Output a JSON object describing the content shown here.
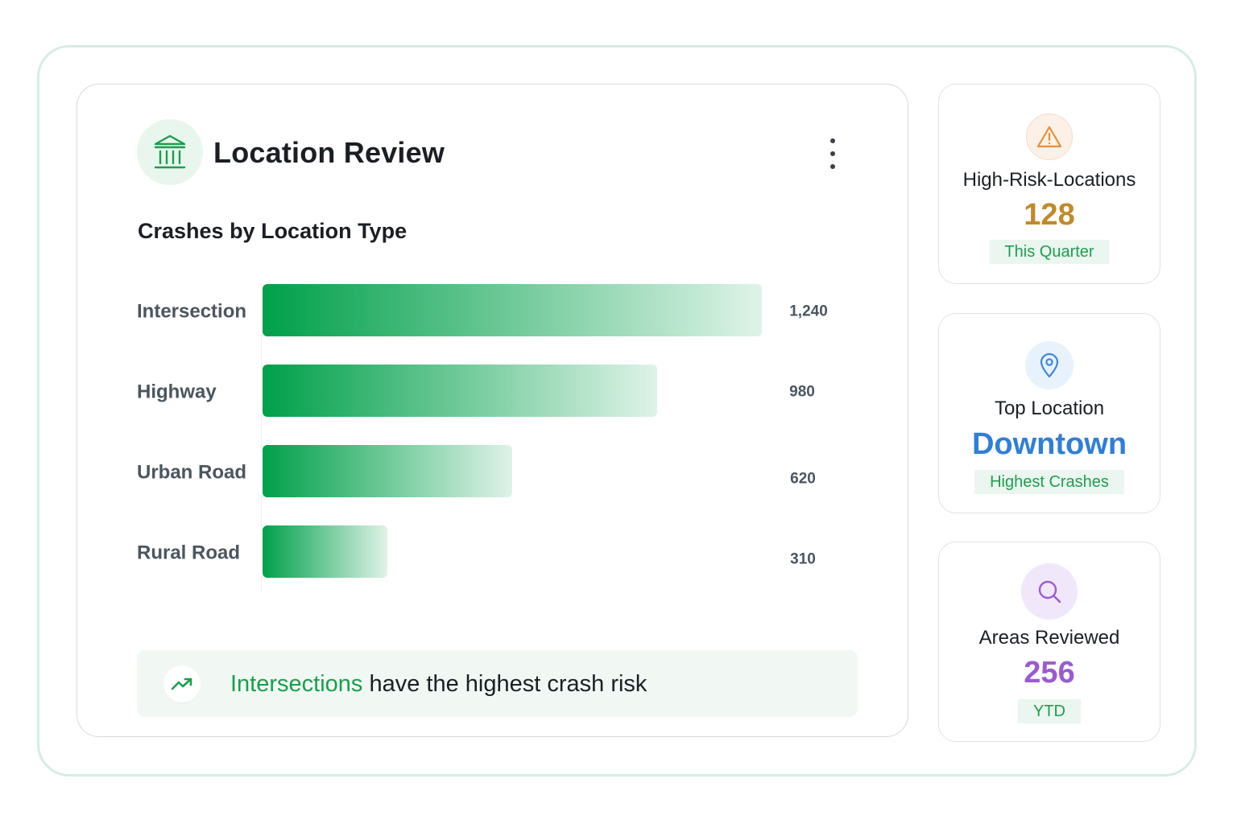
{
  "header": {
    "title": "Location Review",
    "icon": "bank-icon",
    "menu_icon": "more-vertical-icon"
  },
  "chart_data": {
    "type": "bar",
    "orientation": "horizontal",
    "title": "Crashes by Location Type",
    "categories": [
      "Intersection",
      "Highway",
      "Urban Road",
      "Rural Road"
    ],
    "values": [
      1240,
      980,
      620,
      310
    ],
    "value_labels": [
      "1,240",
      "980",
      "620",
      "310"
    ],
    "xlim": [
      0,
      1240
    ],
    "grid": false,
    "colors": {
      "bar_start": "#00a04a",
      "bar_end": "#dff3e8"
    }
  },
  "insight": {
    "icon": "trending-up-icon",
    "highlight": "Intersections",
    "text": " have the highest crash risk"
  },
  "stats": [
    {
      "icon": "warning-icon",
      "label": "High-Risk-Locations",
      "value": "128",
      "badge": "This Quarter",
      "color": "#c08a2a"
    },
    {
      "icon": "map-pin-icon",
      "label": "Top Location",
      "value": "Downtown",
      "badge": "Highest Crashes",
      "color": "#2f7fd6"
    },
    {
      "icon": "search-icon",
      "label": "Areas Reviewed",
      "value": "256",
      "badge": "YTD",
      "color": "#9a5bd0"
    }
  ],
  "colors": {
    "accent": "#18a04b",
    "frame": "#d5ede3"
  }
}
